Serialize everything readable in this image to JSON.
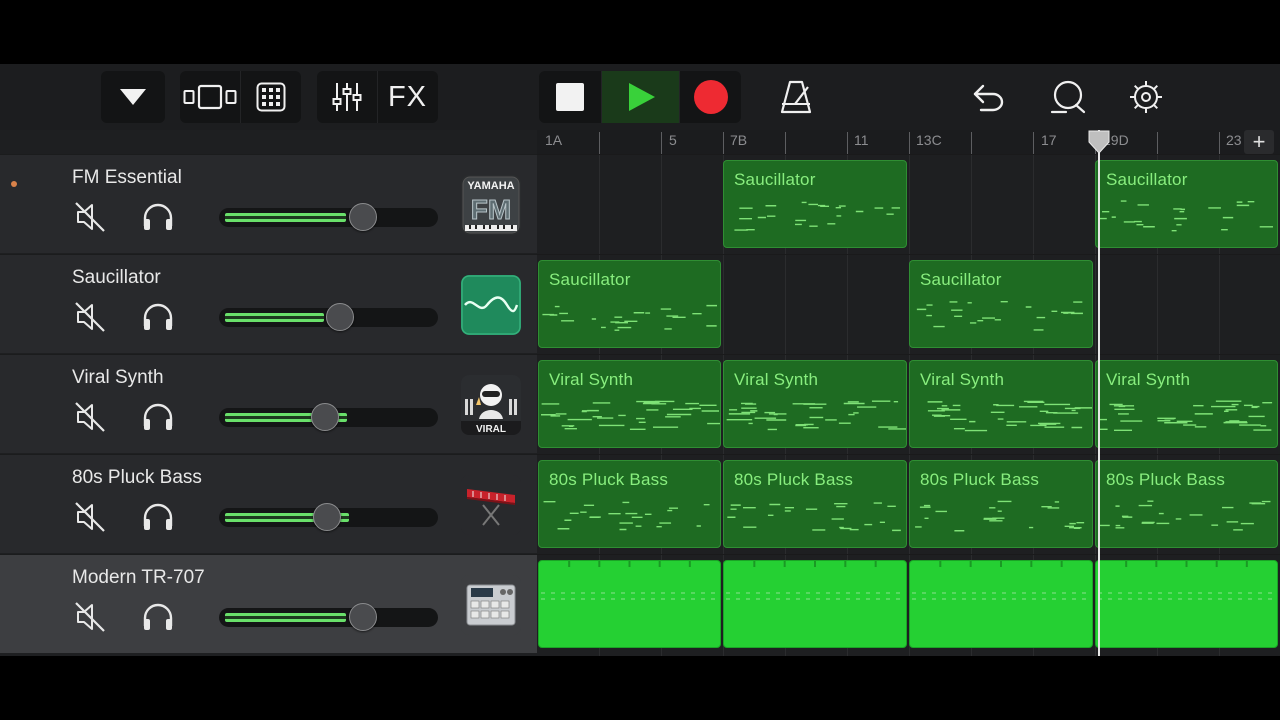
{
  "toolbar": {
    "fx_label": "FX"
  },
  "colors": {
    "region_fill": "#1e6b22",
    "region_label": "#88ee7e",
    "drum_fill": "#25d033",
    "record": "#ee2a32",
    "play": "#39d13a",
    "volume_level": "#69e06a"
  },
  "ruler": {
    "markers": [
      "1A",
      "5",
      "7B",
      "11",
      "13C",
      "17",
      "19D",
      "23"
    ]
  },
  "tracks": [
    {
      "name": "FM Essential",
      "volume": 0.68,
      "icon": "yamaha-fm-icon",
      "icon_text_top": "YAMAHA",
      "icon_text_main": "FM",
      "recording": true,
      "selected": false
    },
    {
      "name": "Saucillator",
      "volume": 0.56,
      "icon": "saucillator-wave-icon",
      "recording": false,
      "selected": false
    },
    {
      "name": "Viral Synth",
      "volume": 0.48,
      "icon": "viral-synth-icon",
      "icon_text_main": "VIRAL",
      "recording": false,
      "selected": false
    },
    {
      "name": "80s Pluck Bass",
      "volume": 0.49,
      "icon": "keyboard-synth-icon",
      "recording": false,
      "selected": false
    },
    {
      "name": "Modern TR-707",
      "volume": 0.68,
      "icon": "drum-machine-icon",
      "recording": false,
      "selected": true
    }
  ],
  "regions": [
    {
      "track": 0,
      "label": "Saucillator",
      "start": 2,
      "end": 4
    },
    {
      "track": 0,
      "label": "Saucillator",
      "start": 6,
      "end": 8
    },
    {
      "track": 1,
      "label": "Saucillator",
      "start": 0,
      "end": 2
    },
    {
      "track": 1,
      "label": "Saucillator",
      "start": 4,
      "end": 6
    },
    {
      "track": 2,
      "label": "Viral Synth",
      "start": 0,
      "end": 2
    },
    {
      "track": 2,
      "label": "Viral Synth",
      "start": 2,
      "end": 4
    },
    {
      "track": 2,
      "label": "Viral Synth",
      "start": 4,
      "end": 6
    },
    {
      "track": 2,
      "label": "Viral Synth",
      "start": 6,
      "end": 8
    },
    {
      "track": 3,
      "label": "80s Pluck Bass",
      "start": 0,
      "end": 2
    },
    {
      "track": 3,
      "label": "80s Pluck Bass",
      "start": 2,
      "end": 4
    },
    {
      "track": 3,
      "label": "80s Pluck Bass",
      "start": 4,
      "end": 6
    },
    {
      "track": 3,
      "label": "80s Pluck Bass",
      "start": 6,
      "end": 8
    },
    {
      "track": 4,
      "label": "",
      "start": 0,
      "end": 2,
      "drum": true
    },
    {
      "track": 4,
      "label": "",
      "start": 2,
      "end": 4,
      "drum": true
    },
    {
      "track": 4,
      "label": "",
      "start": 4,
      "end": 6,
      "drum": true
    },
    {
      "track": 4,
      "label": "",
      "start": 6,
      "end": 8,
      "drum": true
    }
  ],
  "playhead_bar": 19.3
}
